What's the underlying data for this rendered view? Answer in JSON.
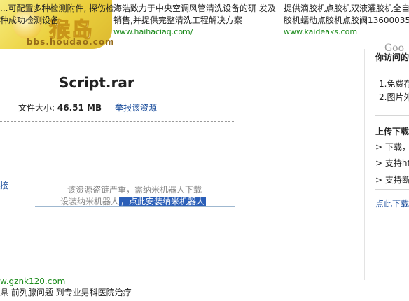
{
  "site_logo": {
    "title": "猴岛",
    "url": "bbs.houdao.com"
  },
  "ads": [
    {
      "line1": "...可配置多种检测附件, 探伤检",
      "line2": "种成功检测设备",
      "url": ""
    },
    {
      "line1": "海浩致力于中央空调风管清洗设备的研 发及",
      "line2": "销售,并提供完整清洗工程解决方案",
      "url": "www.haihaciaq.com/"
    },
    {
      "line1": "提供滴胶机点胶机双液灌胶机全自",
      "line2": "胶机蠕动点胶机点胶阀13600035",
      "url": "www.kaideaks.com"
    }
  ],
  "main": {
    "file_title": "Script.rar",
    "size_label": "文件大小:",
    "size_value": "46.51 MB",
    "report_link": "举报该资源",
    "left_link": "接",
    "notice_line1": "该资源盗链严重，需纳米机器人下载",
    "notice_line2_prefix": "设装纳米机器人",
    "notice_line2_link": "，点此安装纳米机器人"
  },
  "bottom_ad": {
    "url": "w.gznk120.com",
    "text": "県 前列腺问题 到专业男科医院治疗"
  },
  "sidebar": {
    "search_watermark": "Goo",
    "section1_title": "你访问的",
    "section1_items": [
      "1.免费存",
      "2.图片外"
    ],
    "section2_title": "上传下载",
    "section2_items": [
      "> 下载，",
      "> 支持htt",
      "> 支持断"
    ],
    "bottom_link": "点此下载"
  }
}
